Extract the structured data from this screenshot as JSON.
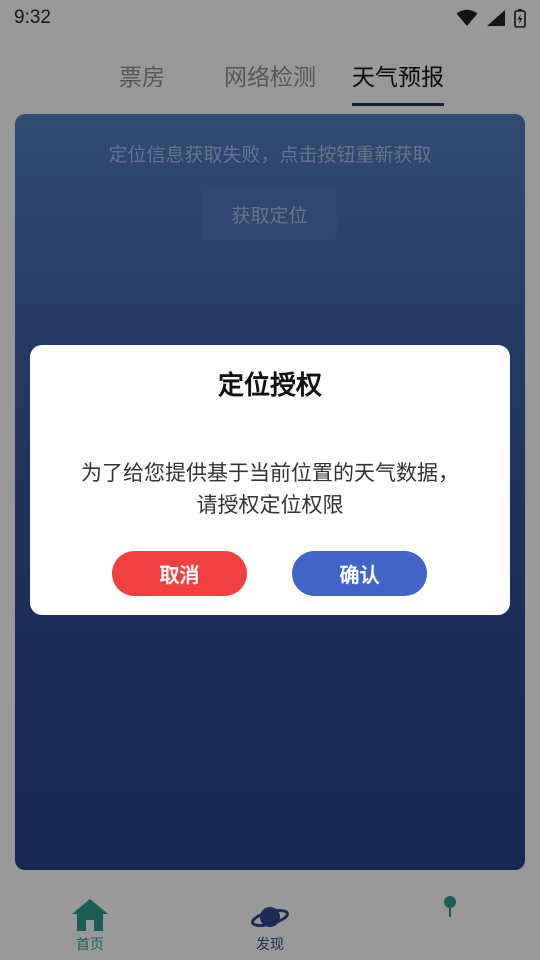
{
  "status_bar": {
    "time": "9:32",
    "icons": [
      "wifi-icon",
      "signal-icon",
      "battery-charging-icon"
    ]
  },
  "tabs": [
    {
      "label": "票房",
      "active": false
    },
    {
      "label": "网络检测",
      "active": false
    },
    {
      "label": "天气预报",
      "active": true
    }
  ],
  "weather": {
    "message": "定位信息获取失败，点击按钮重新获取",
    "button_label": "获取定位"
  },
  "bottom_nav": [
    {
      "label": "首页",
      "icon": "home-icon"
    },
    {
      "label": "发现",
      "icon": "planet-icon"
    },
    {
      "label": "",
      "icon": "pin-icon"
    }
  ],
  "dialog": {
    "title": "定位授权",
    "message_line1": "为了给您提供基于当前位置的天气数据，",
    "message_line2": "请授权定位权限",
    "cancel_label": "取消",
    "confirm_label": "确认"
  },
  "colors": {
    "accent": "#2aa59a",
    "cancel": "#f04040",
    "confirm": "#4164c8",
    "card_top": "#4f7fc0",
    "card_bottom": "#28408a"
  }
}
